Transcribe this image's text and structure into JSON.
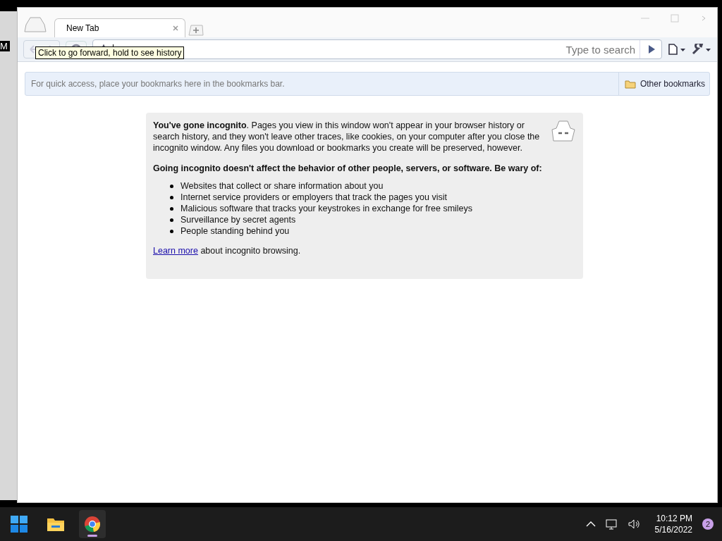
{
  "desktop": {
    "label": "M"
  },
  "tabs": [
    {
      "label": "New Tab",
      "selected": true
    }
  ],
  "tooltip": "Click to go forward, hold to see history",
  "toolbar": {
    "search_placeholder": "Type to search"
  },
  "bookmarks_bar": {
    "hint": "For quick access, place your bookmarks here in the bookmarks bar.",
    "other": "Other bookmarks"
  },
  "incognito": {
    "intro": "**You've gone incognito**. Pages you view in this window won't appear in your browser history or search history, and they won't leave other traces, like cookies, on your computer after you close the incognito window. Any files you download or bookmarks you create will be preserved, however.",
    "warning": "Going incognito doesn't affect the behavior of other people, servers, or software. Be wary of:",
    "items": [
      "Websites that collect or share information about you",
      "Internet service providers or employers that track the pages you visit",
      "Malicious software that tracks your keystrokes in exchange for free smileys",
      "Surveillance by secret agents",
      "People standing behind you"
    ],
    "learn_more": "Learn more",
    "learn_more_rest": "about incognito browsing."
  },
  "taskbar": {
    "apps": [
      {
        "kind": "start",
        "selected": false
      },
      {
        "kind": "files",
        "selected": false
      },
      {
        "kind": "chrome",
        "selected": true
      }
    ],
    "time": "10:12 PM",
    "date": "5/16/2022",
    "badge": "2"
  }
}
